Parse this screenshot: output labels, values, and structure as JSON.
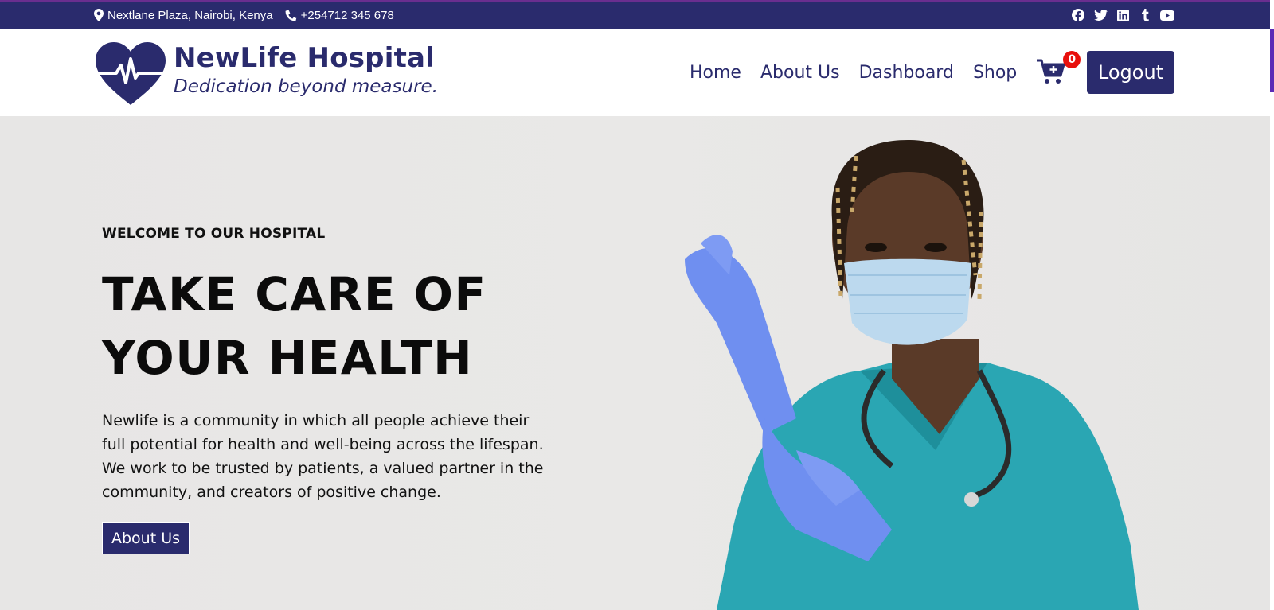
{
  "colors": {
    "brand": "#2a2b6d",
    "badge": "#e8100c"
  },
  "topbar": {
    "address": "Nextlane Plaza, Nairobi, Kenya",
    "phone": "+254712 345 678",
    "social_icons": [
      "facebook-icon",
      "twitter-icon",
      "linkedin-icon",
      "tumblr-icon",
      "youtube-icon"
    ]
  },
  "brand": {
    "name": "NewLife Hospital",
    "tagline": "Dedication beyond measure."
  },
  "nav": {
    "items": [
      {
        "label": "Home"
      },
      {
        "label": "About Us"
      },
      {
        "label": "Dashboard"
      },
      {
        "label": "Shop"
      }
    ],
    "cart_count": "0",
    "logout_label": "Logout"
  },
  "hero": {
    "eyebrow": "WELCOME TO OUR HOSPITAL",
    "headline_line1": "TAKE CARE OF",
    "headline_line2": "YOUR HEALTH",
    "lead": "Newlife is a community in which all people achieve their full potential for health and well-being across the lifespan. We work to be trusted by patients, a valued partner in the community, and creators of positive change.",
    "button_label": "About Us"
  }
}
